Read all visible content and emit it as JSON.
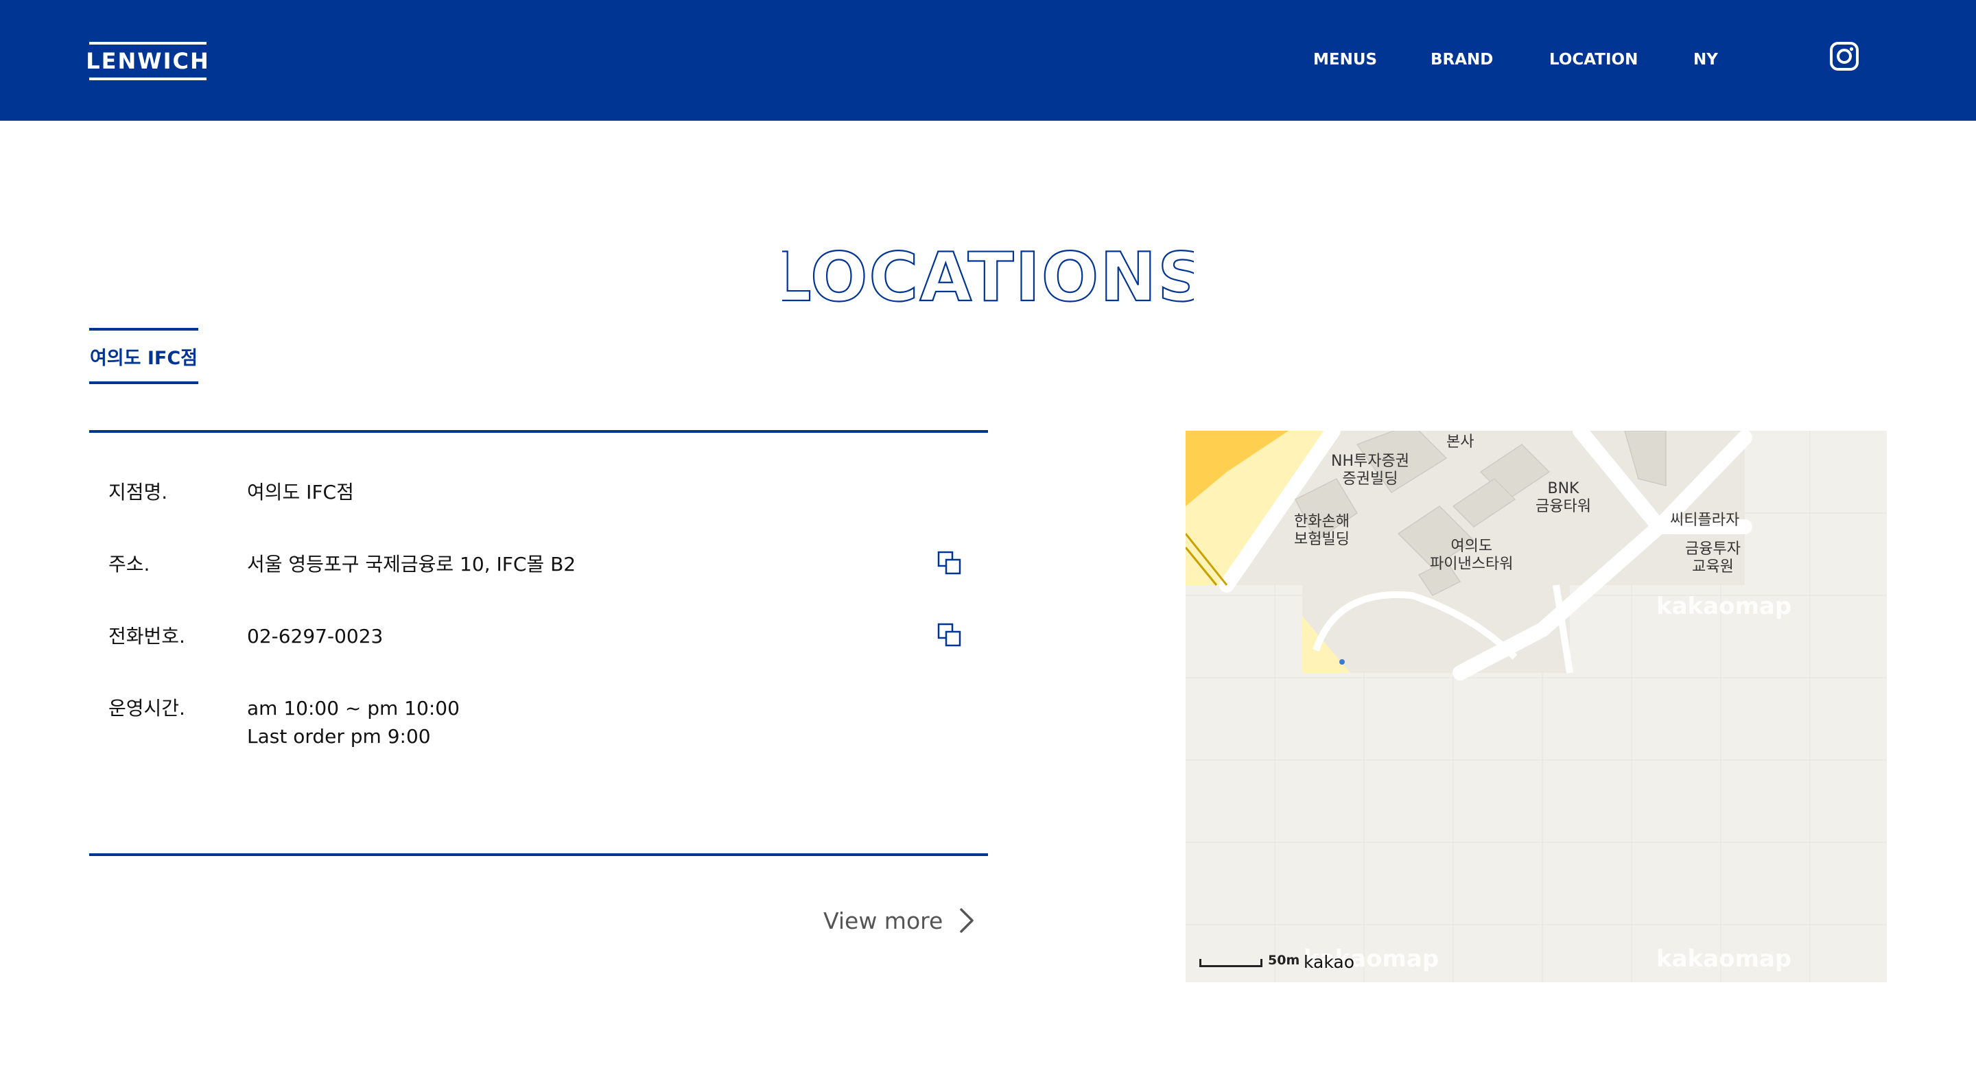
{
  "header": {
    "logo_text": "LENWICH",
    "nav": [
      "MENUS",
      "BRAND",
      "LOCATION",
      "NY"
    ],
    "social_icon": "instagram-icon"
  },
  "page": {
    "title": "LOCATIONS"
  },
  "tabs": [
    {
      "label": "여의도 IFC점",
      "active": true
    }
  ],
  "store": {
    "rows": [
      {
        "label": "지점명.",
        "value": "여의도 IFC점"
      },
      {
        "label": "주소.",
        "value": "서울 영등포구 국제금융로 10, IFC몰 B2"
      },
      {
        "label": "전화번호.",
        "value": "02-6297-0023"
      },
      {
        "label": "운영시간.",
        "value": "am 10:00 ~ pm 10:00",
        "value2": "Last order pm 9:00"
      }
    ],
    "copy_icon": "copy-icon"
  },
  "view_more": {
    "label": "View more",
    "icon": "chevron-right-icon"
  },
  "map": {
    "labels": [
      "본사",
      "NH투자증권\n증권빌딩",
      "BNK\n금융타워",
      "씨티플라자",
      "한화손해\n보험빌딩",
      "여의도\n파이낸스타워",
      "금융투자\n교육원"
    ],
    "watermark": "kakaomap",
    "scale_label": "50m",
    "provider": "kakao"
  },
  "colors": {
    "brand_blue": "#003594",
    "map_bg": "#f2f0eb",
    "map_road": "#ffffff",
    "map_yellow": "#ffd04f"
  }
}
